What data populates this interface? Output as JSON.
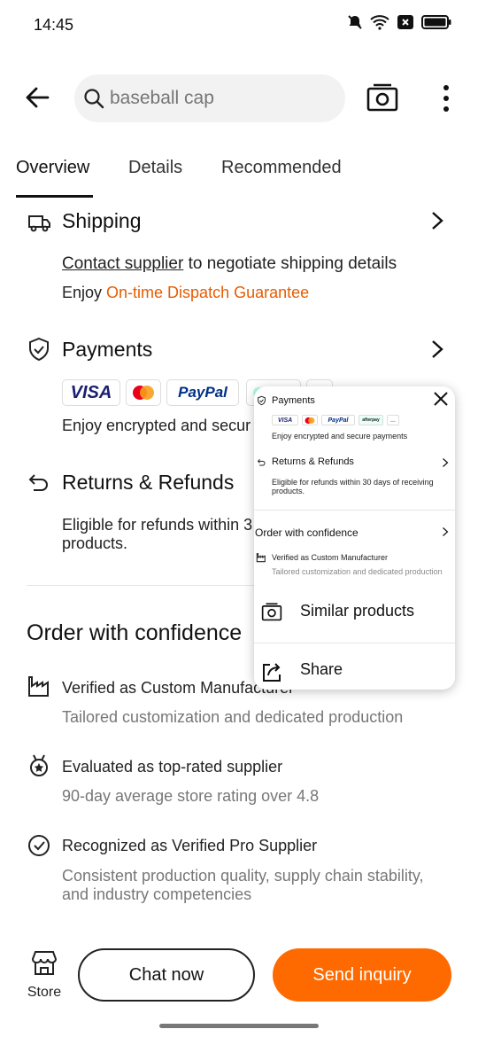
{
  "status_bar": {
    "time": "14:45"
  },
  "header": {
    "search_placeholder": "baseball cap"
  },
  "tabs": [
    {
      "label": "Overview"
    },
    {
      "label": "Details"
    },
    {
      "label": "Recommended"
    }
  ],
  "shipping": {
    "title": "Shipping",
    "contact_link": "Contact supplier",
    "contact_rest": " to negotiate shipping details",
    "enjoy_prefix": "Enjoy ",
    "guarantee": "On-time Dispatch Guarantee"
  },
  "payments": {
    "title": "Payments",
    "methods": [
      "VISA",
      "PayPal"
    ],
    "note": "Enjoy encrypted and secure payments",
    "note_visible": "Enjoy encrypted and secur"
  },
  "returns": {
    "title": "Returns & Refunds",
    "note_line1": "Eligible for refunds within 3",
    "note_line2": "products."
  },
  "confidence": {
    "title": "Order with confidence",
    "items": [
      {
        "title": "Verified as Custom Manufacturer",
        "subtitle": "Tailored customization and dedicated production"
      },
      {
        "title": "Evaluated as top-rated supplier",
        "subtitle": "90-day average store rating over 4.8"
      },
      {
        "title": "Recognized as Verified Pro Supplier",
        "subtitle": "Consistent production quality, supply chain stability,",
        "subtitle2": "and industry competencies"
      }
    ]
  },
  "bottom_bar": {
    "store_label": "Store",
    "chat_label": "Chat now",
    "inquiry_label": "Send inquiry"
  },
  "popup": {
    "payments_title": "Payments",
    "payments_note": "Enjoy encrypted and secure payments",
    "returns_title": "Returns & Refunds",
    "returns_note_1": "Eligible for refunds within 30 days of receiving",
    "returns_note_2": "products.",
    "confidence_title": "Order with confidence",
    "verified_title": "Verified as Custom Manufacturer",
    "verified_subtitle": "Tailored customization and dedicated production",
    "similar_label": "Similar products",
    "share_label": "Share",
    "mini_methods": [
      "VISA",
      "PayPal",
      "afterpay",
      "..."
    ]
  },
  "colors": {
    "accent": "#ff6a00",
    "link_orange": "#e65c00"
  }
}
